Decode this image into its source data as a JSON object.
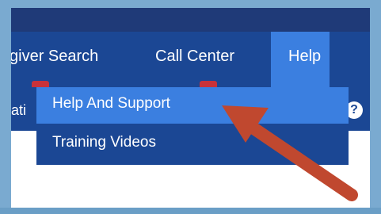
{
  "nav": {
    "caregiver_search": "giver Search",
    "call_center": "Call Center",
    "help": "Help"
  },
  "subbar": {
    "left_text": "ati",
    "help_icon": "?"
  },
  "help_menu": {
    "items": [
      {
        "label": "Help And Support"
      },
      {
        "label": "Training Videos"
      }
    ]
  },
  "annotation": {
    "arrow_color": "#c0482f",
    "icon": "pointer-arrow"
  },
  "colors": {
    "nav_background": "#1b4794",
    "active_tab": "#3b7fe0",
    "marker": "#c8323a"
  }
}
